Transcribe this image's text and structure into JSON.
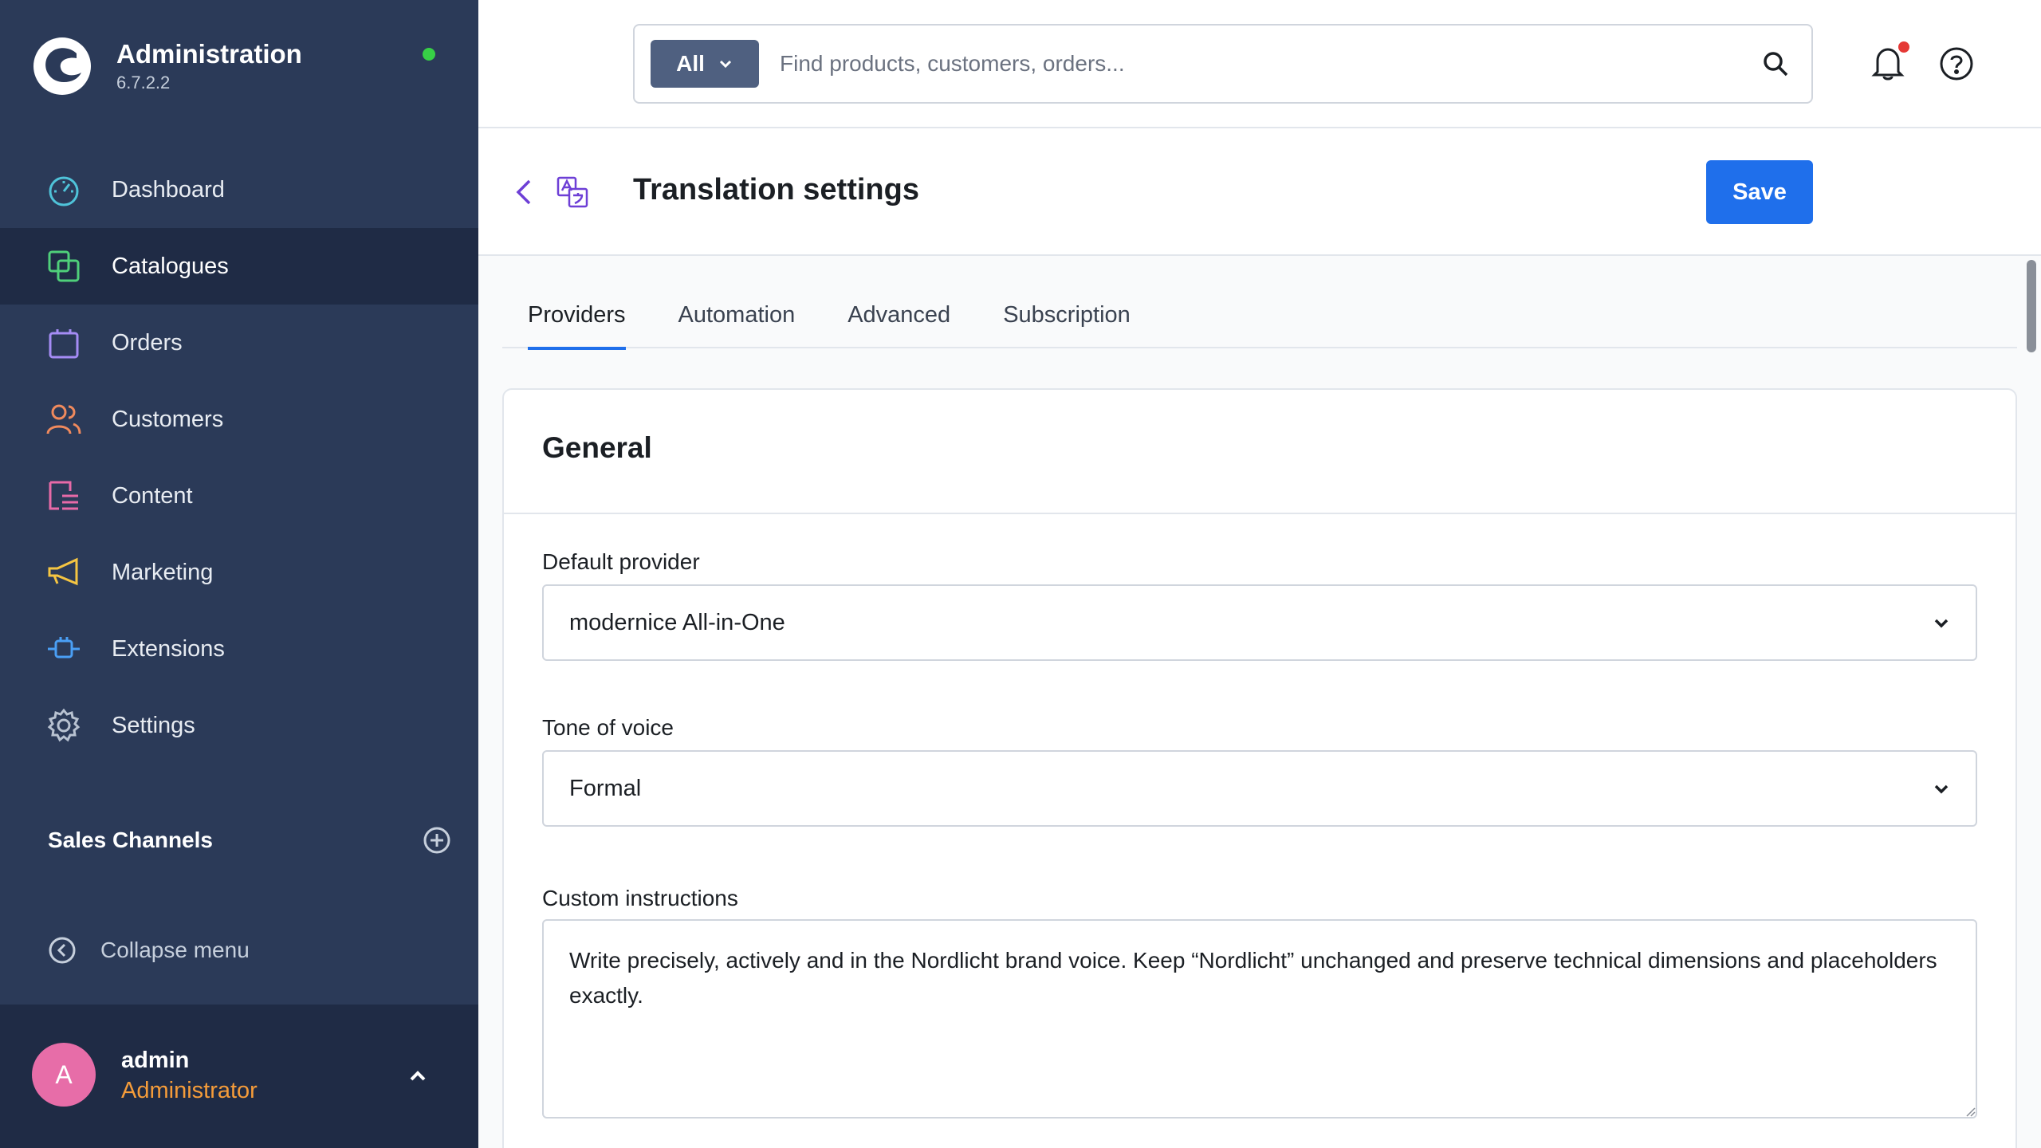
{
  "app": {
    "title": "Administration",
    "version": "6.7.2.2",
    "status_color": "#37d046"
  },
  "sidebar": {
    "items": [
      {
        "label": "Dashboard",
        "icon": "dashboard-gauge-icon",
        "active": false
      },
      {
        "label": "Catalogues",
        "icon": "catalogues-icon",
        "active": true
      },
      {
        "label": "Orders",
        "icon": "orders-bag-icon",
        "active": false
      },
      {
        "label": "Customers",
        "icon": "customers-icon",
        "active": false
      },
      {
        "label": "Content",
        "icon": "content-icon",
        "active": false
      },
      {
        "label": "Marketing",
        "icon": "megaphone-icon",
        "active": false
      },
      {
        "label": "Extensions",
        "icon": "plug-icon",
        "active": false
      },
      {
        "label": "Settings",
        "icon": "gear-icon",
        "active": false
      }
    ],
    "sales_channels_title": "Sales Channels",
    "collapse_label": "Collapse menu"
  },
  "user": {
    "initial": "A",
    "name": "admin",
    "role": "Administrator"
  },
  "search": {
    "type_label": "All",
    "placeholder": "Find products, customers, orders..."
  },
  "page": {
    "title": "Translation settings",
    "save_label": "Save"
  },
  "tabs": [
    {
      "label": "Providers",
      "active": true
    },
    {
      "label": "Automation",
      "active": false
    },
    {
      "label": "Advanced",
      "active": false
    },
    {
      "label": "Subscription",
      "active": false
    }
  ],
  "general": {
    "title": "General",
    "default_provider_label": "Default provider",
    "default_provider_value": "modernice All-in-One",
    "tone_label": "Tone of voice",
    "tone_value": "Formal",
    "custom_instructions_label": "Custom instructions",
    "custom_instructions_value": "Write precisely, actively and in the Nordlicht brand voice. Keep “Nordlicht” unchanged and preserve technical dimensions and placeholders exactly."
  },
  "colors": {
    "sidebar": "#2b3a58",
    "sidebar_active": "#1f2b45",
    "accent": "#1f6feb",
    "role": "#f59c3a",
    "avatar": "#e76da8"
  }
}
